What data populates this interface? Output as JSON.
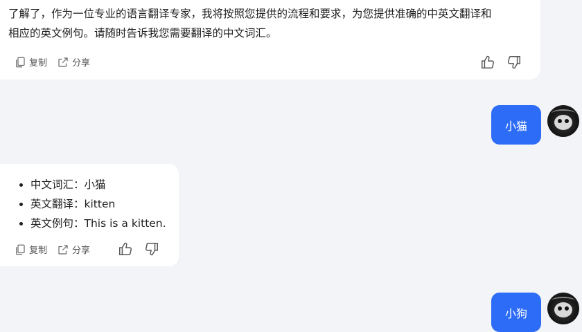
{
  "messages": {
    "assistant_intro": {
      "line1": "了解了，作为一位专业的语言翻译专家，我将按照您提供的流程和要求，为您提供准确的中英文翻译和",
      "line2": "相应的英文例句。请随时告诉我您需要翻译的中文词汇。"
    },
    "user_1": "小猫",
    "assistant_answer": {
      "items": [
        "中文词汇：小猫",
        "英文翻译：kitten",
        "英文例句：This is a kitten."
      ]
    },
    "user_2": "小狗"
  },
  "actions": {
    "copy_label": "复制",
    "share_label": "分享"
  },
  "colors": {
    "accent": "#2c6cf6",
    "background": "#f3f4f8",
    "bubble": "#ffffff"
  },
  "icons": [
    "copy-icon",
    "share-icon",
    "thumbs-up-icon",
    "thumbs-down-icon",
    "avatar"
  ]
}
